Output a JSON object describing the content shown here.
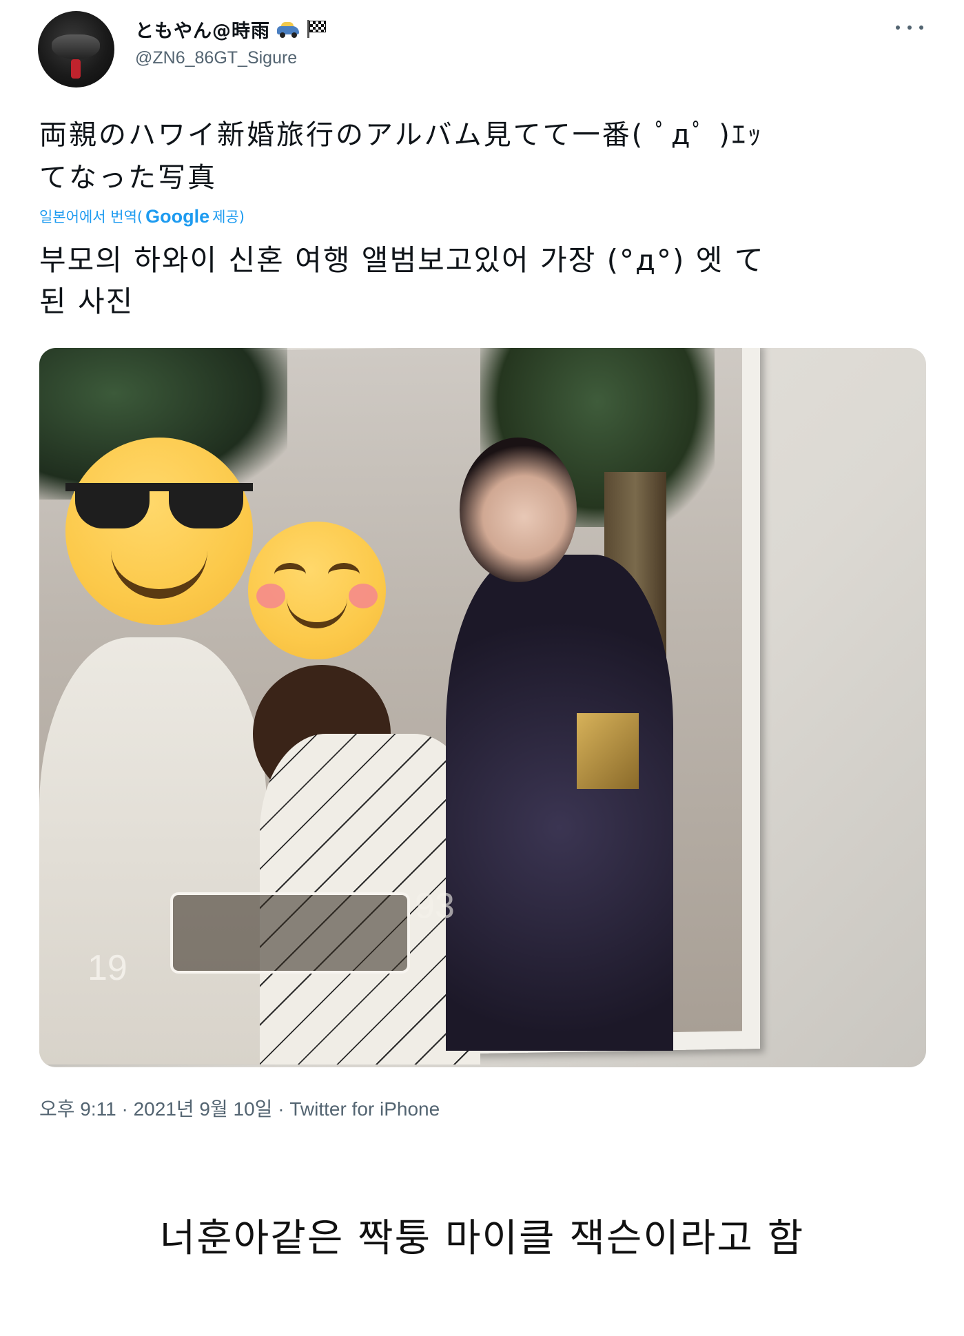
{
  "tweet": {
    "display_name": "ともやん@時雨",
    "handle": "@ZN6_86GT_Sigure",
    "name_emojis": [
      "car-emoji",
      "checkered-flag-emoji"
    ],
    "text_line1": "両親のハワイ新婚旅行のアルバム見てて一番( ﾟдﾟ )ｴｯ",
    "text_line2": "てなった写真",
    "translated_from": "일본어에서 번역(",
    "google_label": "Google",
    "provided_label": "제공)",
    "translation_line1": "부모의 하와이 신혼 여행 앨범보고있어 가장 (°д°) 엣 て",
    "translation_line2": "된 사진",
    "photo": {
      "year_left": "19",
      "year_right": "93",
      "emojis": [
        "sunglasses-face-emoji",
        "smiling-blush-face-emoji"
      ]
    },
    "timestamp": "오후 9:11 · 2021년 9월 10일 · Twitter for iPhone"
  },
  "caption": "너훈아같은 짝퉁 마이클 잭슨이라고 함",
  "colors": {
    "link": "#1d9bf0",
    "muted": "#536471",
    "text": "#0f1419"
  }
}
